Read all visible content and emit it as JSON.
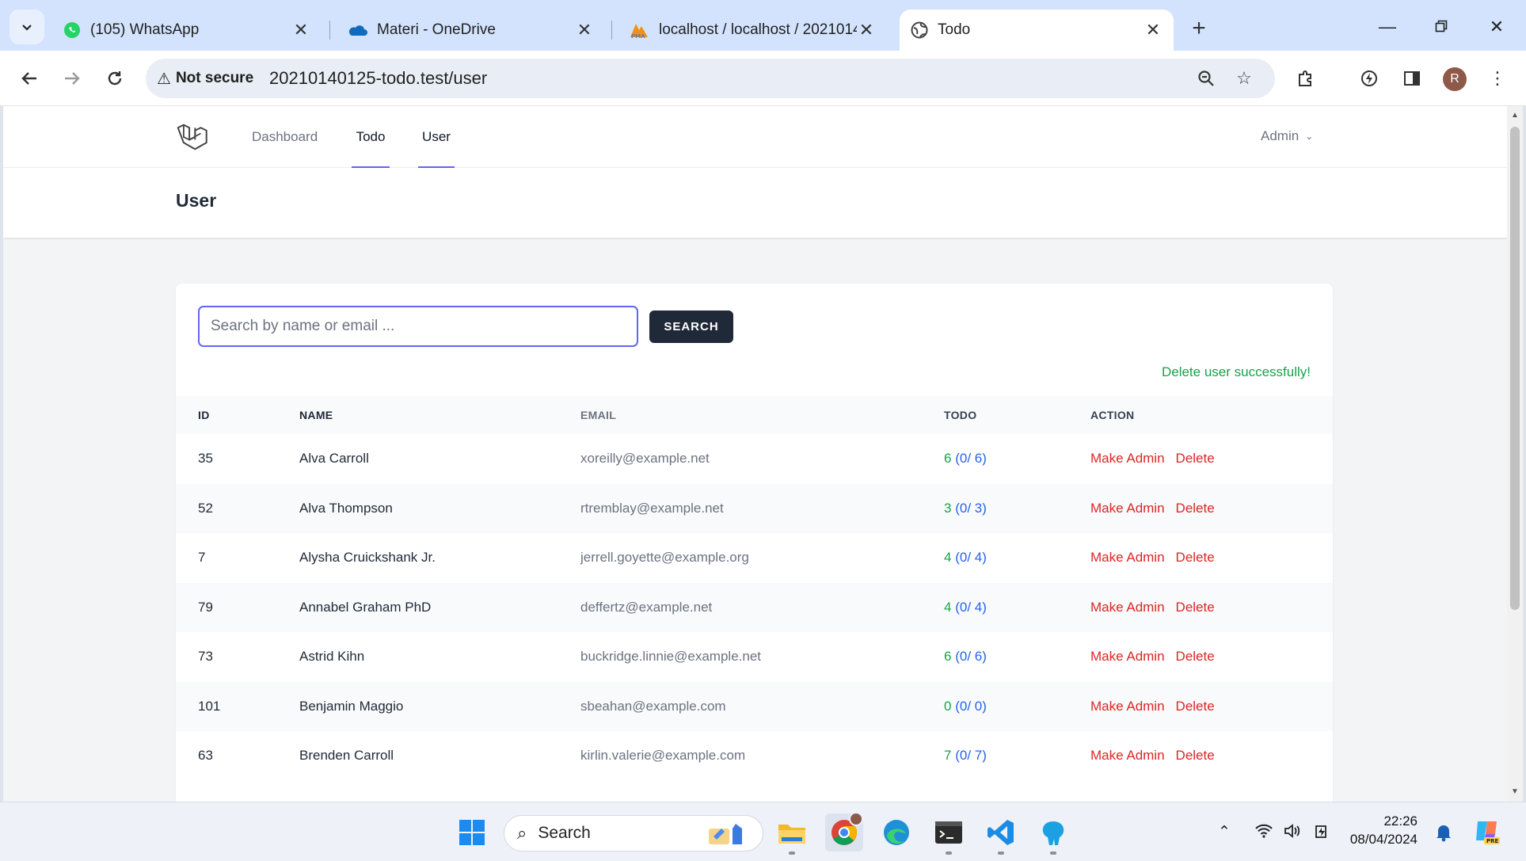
{
  "browser": {
    "tabs": [
      {
        "title": "(105) WhatsApp",
        "icon": "whatsapp-icon",
        "active": false
      },
      {
        "title": "Materi - OneDrive",
        "icon": "onedrive-icon",
        "active": false
      },
      {
        "title": "localhost / localhost / 2021014(",
        "icon": "phpmyadmin-icon",
        "active": false
      },
      {
        "title": "Todo",
        "icon": "globe-icon",
        "active": true
      }
    ],
    "security_label": "Not secure",
    "url": "20210140125-todo.test/user",
    "profile_initial": "R"
  },
  "app": {
    "nav": {
      "dashboard": "Dashboard",
      "todo": "Todo",
      "user": "User",
      "account": "Admin"
    },
    "page_title": "User",
    "search": {
      "placeholder": "Search by name or email ...",
      "button": "SEARCH"
    },
    "flash_message": "Delete user successfully!",
    "table": {
      "columns": {
        "id": "ID",
        "name": "NAME",
        "email": "EMAIL",
        "todo": "TODO",
        "action": "ACTION"
      },
      "actions": {
        "make_admin": "Make Admin",
        "delete": "Delete"
      },
      "rows": [
        {
          "id": "35",
          "name": "Alva Carroll",
          "email": "xoreilly@example.net",
          "todo_count": "6",
          "todo_detail": "(0/ 6)"
        },
        {
          "id": "52",
          "name": "Alva Thompson",
          "email": "rtremblay@example.net",
          "todo_count": "3",
          "todo_detail": "(0/ 3)"
        },
        {
          "id": "7",
          "name": "Alysha Cruickshank Jr.",
          "email": "jerrell.goyette@example.org",
          "todo_count": "4",
          "todo_detail": "(0/ 4)"
        },
        {
          "id": "79",
          "name": "Annabel Graham PhD",
          "email": "deffertz@example.net",
          "todo_count": "4",
          "todo_detail": "(0/ 4)"
        },
        {
          "id": "73",
          "name": "Astrid Kihn",
          "email": "buckridge.linnie@example.net",
          "todo_count": "6",
          "todo_detail": "(0/ 6)"
        },
        {
          "id": "101",
          "name": "Benjamin Maggio",
          "email": "sbeahan@example.com",
          "todo_count": "0",
          "todo_detail": "(0/ 0)"
        },
        {
          "id": "63",
          "name": "Brenden Carroll",
          "email": "kirlin.valerie@example.com",
          "todo_count": "7",
          "todo_detail": "(0/ 7)"
        }
      ]
    }
  },
  "taskbar": {
    "search_label": "Search",
    "time": "22:26",
    "date": "08/04/2024"
  },
  "colors": {
    "accent": "#6366f1",
    "success": "#16a34a",
    "danger": "#dc2626",
    "link": "#2563eb",
    "dark_button": "#1f2937"
  }
}
